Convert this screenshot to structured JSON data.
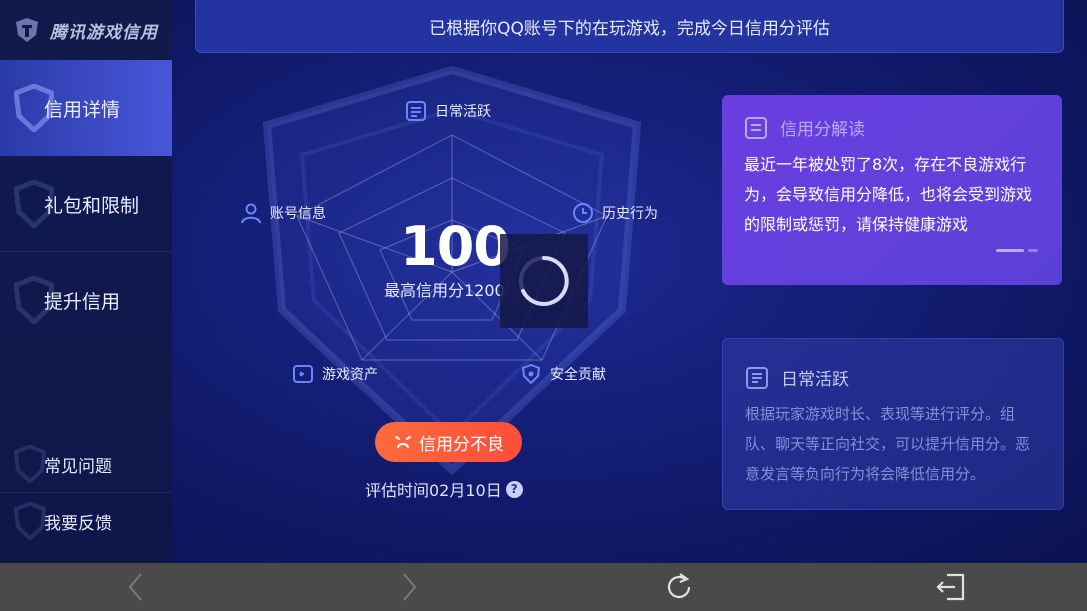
{
  "app": {
    "title": "腾讯游戏信用"
  },
  "sidebar": {
    "items": [
      {
        "label": "信用详情",
        "active": true
      },
      {
        "label": "礼包和限制",
        "active": false
      },
      {
        "label": "提升信用",
        "active": false
      }
    ],
    "footer_items": [
      {
        "label": "常见问题"
      },
      {
        "label": "我要反馈"
      }
    ]
  },
  "banner": {
    "text": "已根据你QQ账号下的在玩游戏，完成今日信用分评估"
  },
  "radar": {
    "axes": [
      {
        "label": "日常活跃",
        "icon": "list-icon"
      },
      {
        "label": "历史行为",
        "icon": "clock-icon"
      },
      {
        "label": "安全贡献",
        "icon": "shield-icon"
      },
      {
        "label": "游戏资产",
        "icon": "wallet-icon"
      },
      {
        "label": "账号信息",
        "icon": "user-icon"
      }
    ]
  },
  "score": {
    "value": "100",
    "max_label": "最高信用分1200"
  },
  "status": {
    "label": "信用分不良",
    "icon": "sad-face-icon",
    "color": "#ff5a3c"
  },
  "eval": {
    "text": "评估时间02月10日",
    "help": "?"
  },
  "cards": {
    "interpretation": {
      "title": "信用分解读",
      "body": "最近一年被处罚了8次，存在不良游戏行为，会导致信用分降低，也将会受到游戏的限制或惩罚，请保持健康游戏"
    },
    "daily": {
      "title": "日常活跃",
      "body": "根据玩家游戏时长、表现等进行评分。组队、聊天等正向社交，可以提升信用分。恶意发言等负向行为将会降低信用分。"
    }
  },
  "bottombar": {
    "icons": [
      "back-arrow-icon",
      "forward-arrow-icon",
      "refresh-icon",
      "exit-icon"
    ]
  },
  "colors": {
    "accent": "#4757d8",
    "card_purple": "#6b3fe0",
    "status_red": "#ff5a3c"
  }
}
